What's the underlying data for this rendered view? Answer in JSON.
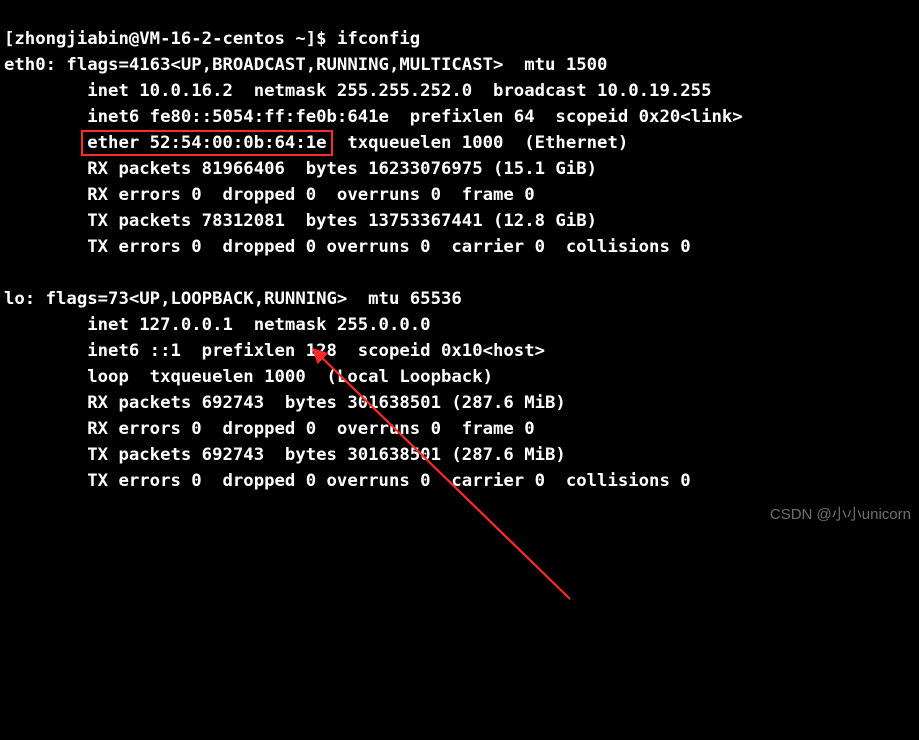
{
  "prompt": "[zhongjiabin@VM-16-2-centos ~]$ ",
  "command": "ifconfig",
  "eth0": {
    "header": "eth0: flags=4163<UP,BROADCAST,RUNNING,MULTICAST>  mtu 1500",
    "inet": "        inet 10.0.16.2  netmask 255.255.252.0  broadcast 10.0.19.255",
    "inet6": "        inet6 fe80::5054:ff:fe0b:641e  prefixlen 64  scopeid 0x20<link>",
    "ether_pre": "        ",
    "ether_box": "ether 52:54:00:0b:64:1e",
    "ether_post": "  txqueuelen 1000  (Ethernet)",
    "rxp": "        RX packets 81966406  bytes 16233076975 (15.1 GiB)",
    "rxe": "        RX errors 0  dropped 0  overruns 0  frame 0",
    "txp": "        TX packets 78312081  bytes 13753367441 (12.8 GiB)",
    "txe": "        TX errors 0  dropped 0 overruns 0  carrier 0  collisions 0"
  },
  "blank": " ",
  "lo": {
    "header": "lo: flags=73<UP,LOOPBACK,RUNNING>  mtu 65536",
    "inet": "        inet 127.0.0.1  netmask 255.0.0.0",
    "inet6": "        inet6 ::1  prefixlen 128  scopeid 0x10<host>",
    "loop": "        loop  txqueuelen 1000  (Local Loopback)",
    "rxp": "        RX packets 692743  bytes 301638501 (287.6 MiB)",
    "rxe": "        RX errors 0  dropped 0  overruns 0  frame 0",
    "txp": "        TX packets 692743  bytes 301638501 (287.6 MiB)",
    "txe": "        TX errors 0  dropped 0 overruns 0  carrier 0  collisions 0"
  },
  "watermark": "CSDN @小小unicorn",
  "highlight_desc": "red box around MAC address line",
  "arrow_desc": "red arrow pointing to MAC address"
}
